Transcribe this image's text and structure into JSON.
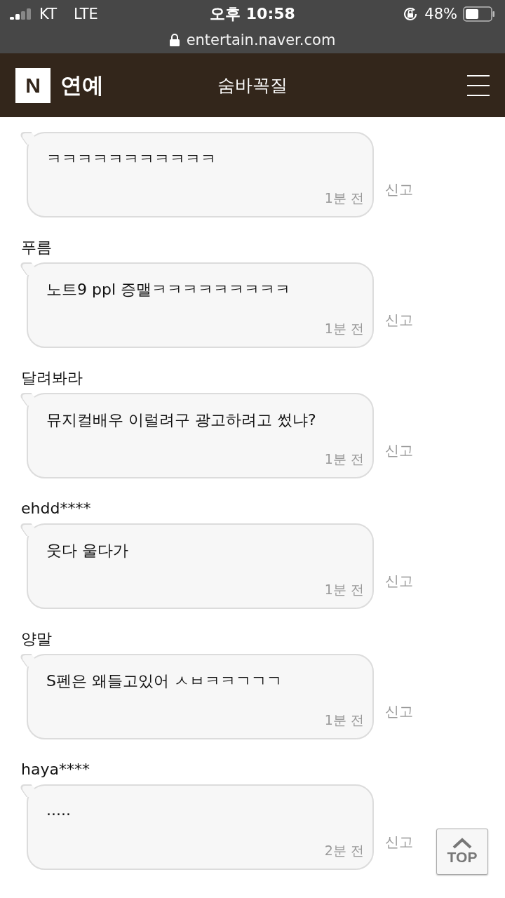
{
  "status_bar": {
    "carrier": "KT",
    "network": "LTE",
    "time": "오후 10:58",
    "battery": "48%"
  },
  "address_bar": {
    "url": "entertain.naver.com"
  },
  "header": {
    "logo": "N",
    "section": "연예",
    "title": "숨바꼭질"
  },
  "comments": [
    {
      "text": "ㅋㅋㅋㅋㅋㅋㅋㅋㅋㅋㅋ",
      "time": "1분 전",
      "report": "신고"
    },
    {
      "author": "푸름",
      "text": "노트9 ppl 증맬ㅋㅋㅋㅋㅋㅋㅋㅋㅋ",
      "time": "1분 전",
      "report": "신고"
    },
    {
      "author": "달려봐라",
      "text": "뮤지컬배우 이럴려구 광고하려고 썼냐?",
      "time": "1분 전",
      "report": "신고"
    },
    {
      "author": "ehdd****",
      "text": "웃다 울다가",
      "time": "1분 전",
      "report": "신고"
    },
    {
      "author": "양말",
      "text": "S펜은 왜들고있어 ㅅㅂㅋㅋㄱㄱㄱ",
      "time": "1분 전",
      "report": "신고"
    },
    {
      "author": "haya****",
      "text": ".....",
      "time": "2분 전",
      "report": "신고"
    }
  ],
  "top_button": {
    "label": "TOP"
  }
}
